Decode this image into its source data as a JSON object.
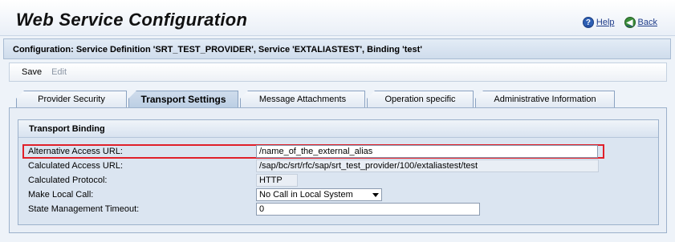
{
  "header": {
    "title": "Web Service Configuration",
    "help_label": "Help",
    "back_label": "Back"
  },
  "config": {
    "text": "Configuration: Service Definition 'SRT_TEST_PROVIDER', Service 'EXTALIASTEST', Binding 'test'"
  },
  "toolbar": {
    "save_label": "Save",
    "edit_label": "Edit"
  },
  "tabs": [
    {
      "label": "Provider Security"
    },
    {
      "label": "Transport Settings"
    },
    {
      "label": "Message Attachments"
    },
    {
      "label": "Operation specific"
    },
    {
      "label": "Administrative Information"
    }
  ],
  "transport_binding": {
    "title": "Transport Binding",
    "fields": {
      "alt_url": {
        "label": "Alternative Access URL:",
        "value": "/name_of_the_external_alias"
      },
      "calc_url": {
        "label": "Calculated Access URL:",
        "value": "/sap/bc/srt/rfc/sap/srt_test_provider/100/extaliastest/test"
      },
      "calc_protocol": {
        "label": "Calculated Protocol:",
        "value": "HTTP"
      },
      "local_call": {
        "label": "Make Local Call:",
        "value": "No Call in Local System"
      },
      "state_timeout": {
        "label": "State Management Timeout:",
        "value": "0"
      }
    }
  },
  "colors": {
    "highlight": "#e0202a",
    "link": "#1f3d8a"
  }
}
